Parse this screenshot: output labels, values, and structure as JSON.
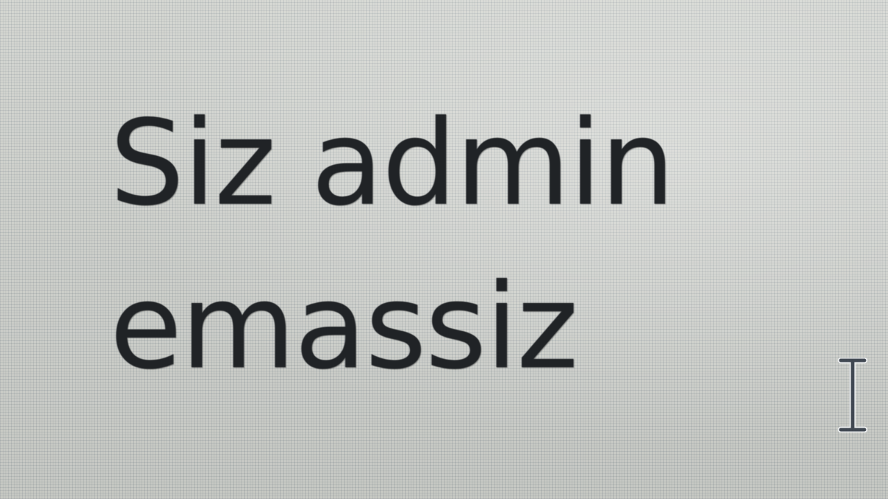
{
  "message": {
    "text": "Siz admin\nemassiz"
  },
  "cursor": {
    "icon": "text-cursor-icon"
  },
  "colors": {
    "background": "#d2d4cf",
    "text": "#202326",
    "cursor": "#2b3340"
  }
}
